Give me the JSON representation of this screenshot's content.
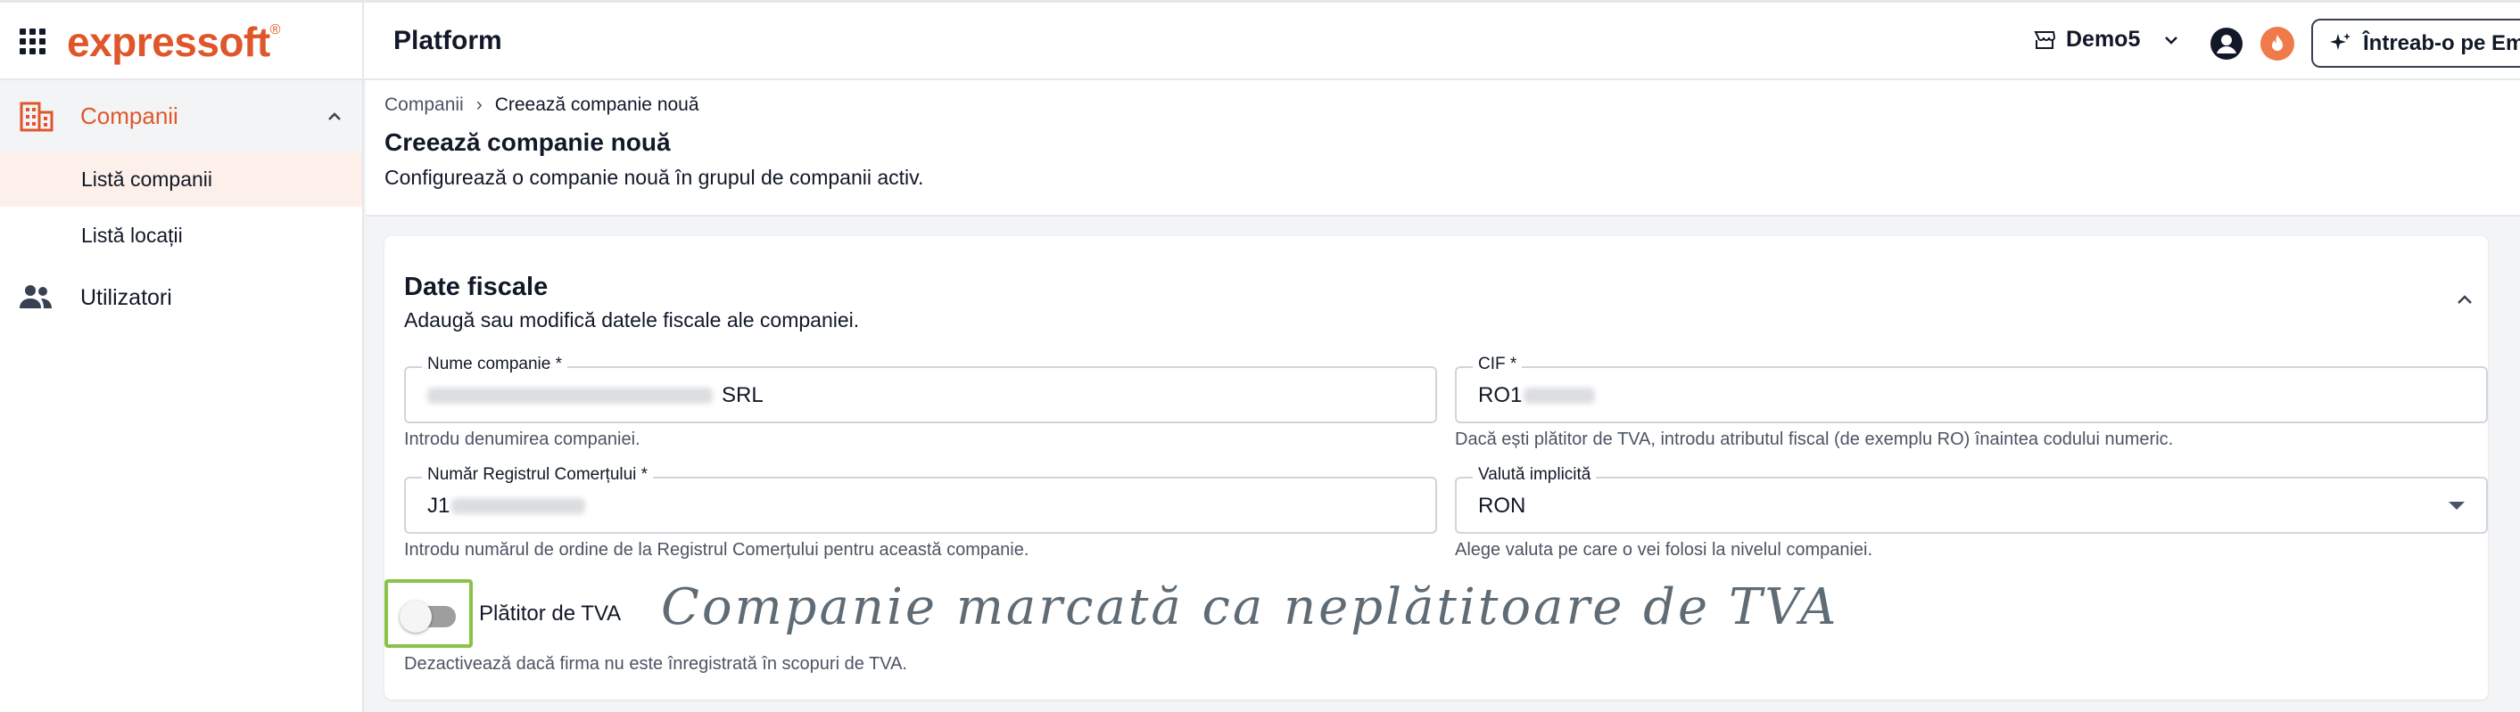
{
  "topbar": {
    "logo": "expressoft",
    "logo_mark": "®",
    "platform_title": "Platform",
    "org_name": "Demo5",
    "ai_button_label": "Întreab-o pe Ema"
  },
  "sidebar": {
    "group_label": "Companii",
    "sub_items": [
      {
        "label": "Listă companii",
        "active": true
      },
      {
        "label": "Listă locații",
        "active": false
      }
    ],
    "users_label": "Utilizatori"
  },
  "breadcrumb": {
    "root": "Companii",
    "separator": "›",
    "current": "Creează companie nouă"
  },
  "page": {
    "title": "Creează companie nouă",
    "subtitle": "Configurează o companie nouă în grupul de companii activ."
  },
  "card": {
    "title": "Date fiscale",
    "subtitle": "Adaugă sau modifică datele fiscale ale companiei.",
    "fields": {
      "company_name": {
        "label": "Nume companie *",
        "value_suffix": "SRL",
        "helper": "Introdu denumirea companiei."
      },
      "cif": {
        "label": "CIF *",
        "value_prefix": "RO1",
        "helper": "Dacă ești plătitor de TVA, introdu atributul fiscal (de exemplu RO) înaintea codului numeric."
      },
      "trade_register": {
        "label": "Număr Registrul Comerțului *",
        "value_prefix": "J1",
        "helper": "Introdu numărul de ordine de la Registrul Comerțului pentru această companie."
      },
      "currency": {
        "label": "Valută implicită",
        "value": "RON",
        "helper": "Alege valuta pe care o vei folosi la nivelul companiei."
      }
    },
    "vat_toggle": {
      "label": "Plătitor de TVA",
      "checked": false,
      "helper": "Dezactivează dacă firma nu este înregistrată în scopuri de TVA."
    },
    "annotation": "Companie marcată ca neplătitoare de TVA"
  },
  "colors": {
    "brand": "#e0562b",
    "highlight_frame": "#8bc34a"
  }
}
